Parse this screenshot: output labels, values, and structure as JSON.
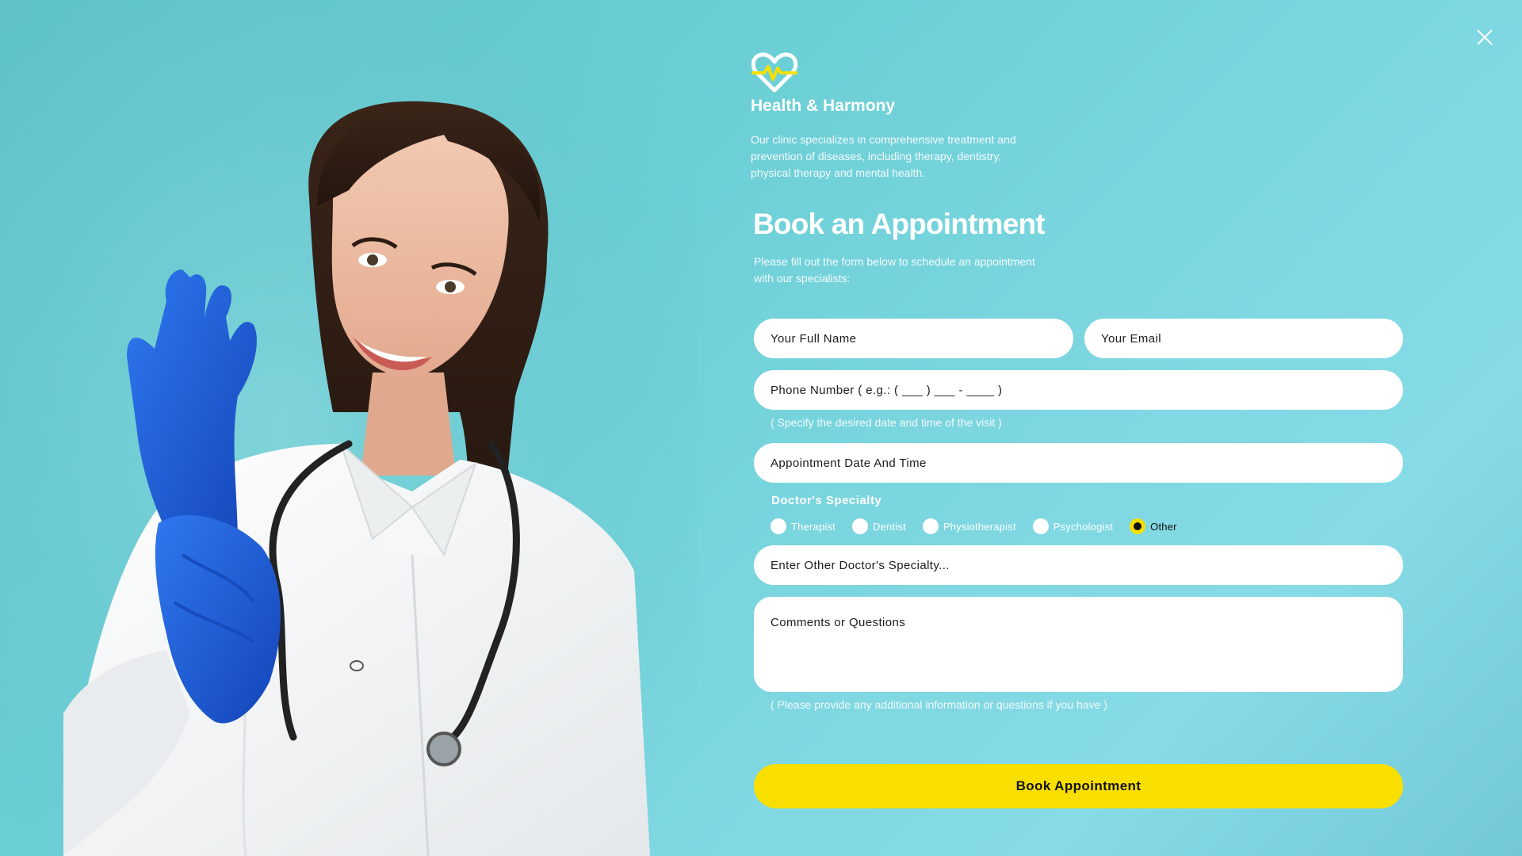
{
  "brand": {
    "name": "Health & Harmony",
    "description": "Our clinic specializes in comprehensive treatment and prevention of diseases, including therapy, dentistry, physical therapy and mental health.",
    "logo_icon": "heart-pulse-icon",
    "colors": {
      "accent": "#f9df00",
      "logo_outline": "#ffffff",
      "logo_pulse": "#f9df00"
    }
  },
  "close_icon": "close-icon",
  "form": {
    "title": "Book an Appointment",
    "subtitle": "Please fill out the form below to schedule an appointment with our specialists:",
    "full_name": {
      "placeholder": "Your Full Name",
      "value": ""
    },
    "email": {
      "placeholder": "Your Email",
      "value": ""
    },
    "phone": {
      "placeholder": "Phone Number ( e.g.: ( ___ ) ___ - ____ )",
      "value": ""
    },
    "date_hint": "( Specify the desired date and time of the visit )",
    "date": {
      "placeholder": "Appointment Date And Time",
      "value": ""
    },
    "specialty": {
      "label": "Doctor's Specialty",
      "options": [
        "Therapist",
        "Dentist",
        "Physiotherapist",
        "Psychologist",
        "Other"
      ],
      "selected": "Other"
    },
    "other_specialty": {
      "placeholder": "Enter Other Doctor's Specialty...",
      "value": ""
    },
    "comments": {
      "placeholder": "Comments or Questions",
      "value": ""
    },
    "comments_hint": "( Please provide any additional information or questions if you have )",
    "submit_label": "Book Appointment"
  },
  "colors": {
    "background": "#6ccfd6",
    "field_bg": "#ffffff",
    "submit_bg": "#f9df00",
    "radio_selected": "#f9df00",
    "glove": "#1f63e0"
  }
}
